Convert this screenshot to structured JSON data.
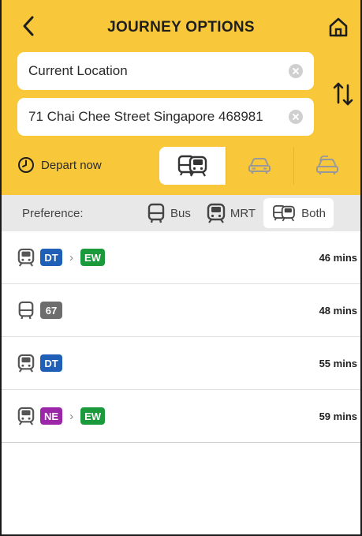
{
  "header": {
    "title": "JOURNEY OPTIONS",
    "from": "Current Location",
    "to": "71 Chai Chee Street Singapore 468981",
    "depart_label": "Depart now",
    "accent_color": "#f8c83a"
  },
  "mode_tabs": [
    {
      "icon": "transit-icon",
      "active": true
    },
    {
      "icon": "car-icon",
      "active": false
    },
    {
      "icon": "taxi-icon",
      "active": false
    }
  ],
  "preference": {
    "label": "Preference:",
    "options": [
      {
        "label": "Bus",
        "icon": "bus-icon",
        "active": false
      },
      {
        "label": "MRT",
        "icon": "train-icon",
        "active": false
      },
      {
        "label": "Both",
        "icon": "bus-train-icon",
        "active": true
      }
    ]
  },
  "routes": [
    {
      "mode_icon": "train-icon",
      "segments": [
        {
          "code": "DT",
          "color": "#1f5fb8"
        },
        {
          "code": "EW",
          "color": "#1b9a3c"
        }
      ],
      "duration": "46 mins"
    },
    {
      "mode_icon": "bus-icon",
      "segments": [
        {
          "code": "67",
          "color": "#6d6d6d"
        }
      ],
      "duration": "48 mins"
    },
    {
      "mode_icon": "train-icon",
      "segments": [
        {
          "code": "DT",
          "color": "#1f5fb8"
        }
      ],
      "duration": "55 mins"
    },
    {
      "mode_icon": "train-icon",
      "segments": [
        {
          "code": "NE",
          "color": "#9b27a8"
        },
        {
          "code": "EW",
          "color": "#1b9a3c"
        }
      ],
      "duration": "59 mins"
    }
  ]
}
